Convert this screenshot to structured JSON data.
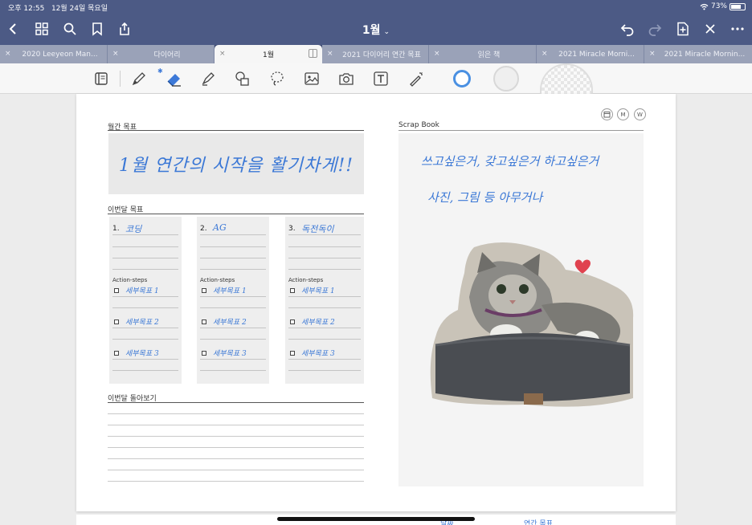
{
  "status": {
    "time": "오후 12:55",
    "date": "12월 24일 목요일",
    "battery": "73%"
  },
  "nav": {
    "title": "1월",
    "title_chevron": "⌄"
  },
  "tabs": [
    {
      "label": "2020 Leeyeon Man..."
    },
    {
      "label": "다이어리"
    },
    {
      "label": "1월"
    },
    {
      "label": "2021 다이어리 연간 목표"
    },
    {
      "label": "읽은 책"
    },
    {
      "label": "2021 Miracle Morni..."
    },
    {
      "label": "2021 Miracle Mornin..."
    }
  ],
  "tab_close": "×",
  "toolbar": {
    "bluetooth": "✱"
  },
  "colors": {
    "nav_bg": "#4c5a85",
    "ink_blue": "#3b78d6",
    "active_color": "#4a90e2",
    "heart": "#e0424f"
  },
  "page": {
    "mini_buttons": {
      "calendar": "",
      "m": "M",
      "w": "W"
    },
    "monthly_goal": {
      "label": "월간 목표",
      "text": "1월 연간의 시작을 활기차게!!"
    },
    "this_month_goals": {
      "label": "이번달 목표",
      "action_steps_label": "Action-steps",
      "columns": [
        {
          "number": "1.",
          "title": "코딩",
          "steps": [
            "세부목표 1",
            "세부목표 2",
            "세부목표 3"
          ]
        },
        {
          "number": "2.",
          "title": "AG",
          "steps": [
            "세부목표 1",
            "세부목표 2",
            "세부목표 3"
          ]
        },
        {
          "number": "3.",
          "title": "독전독이",
          "steps": [
            "세부목표 1",
            "세부목표 2",
            "세부목표 3"
          ]
        }
      ]
    },
    "review": {
      "label": "이번달 돌아보기"
    },
    "scrap_book": {
      "label": "Scrap Book",
      "lines": [
        "쓰고싶은거, 갖고싶은거 하고싶은거",
        "사진, 그림 등 아무거나"
      ]
    }
  },
  "next_page_peek": [
    "날짜",
    "연간 목표"
  ]
}
